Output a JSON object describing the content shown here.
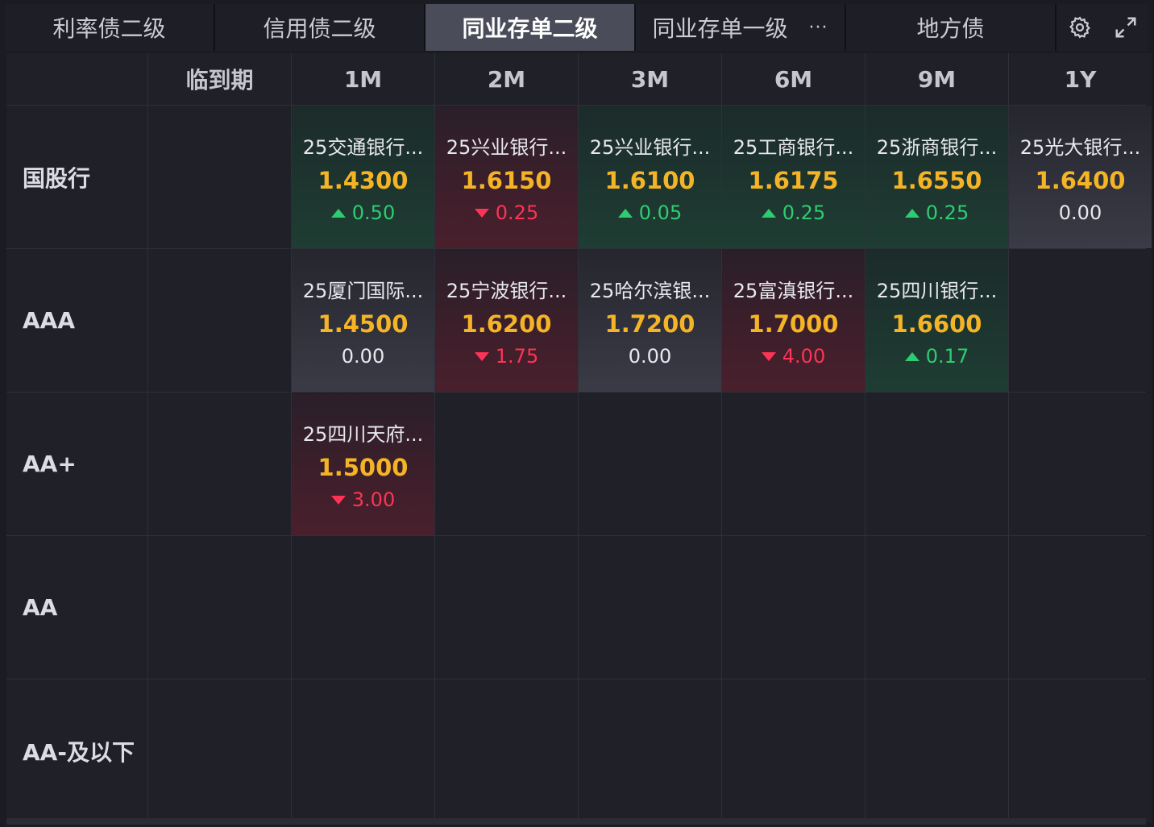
{
  "tabs": [
    {
      "label": "利率债二级",
      "active": false
    },
    {
      "label": "信用债二级",
      "active": false
    },
    {
      "label": "同业存单二级",
      "active": true
    },
    {
      "label": "同业存单一级",
      "active": false,
      "more": "···"
    },
    {
      "label": "地方债",
      "active": false
    }
  ],
  "tools": {
    "settings_icon": "gear-icon",
    "expand_icon": "expand-icon"
  },
  "columns": [
    "临到期",
    "1M",
    "2M",
    "3M",
    "6M",
    "9M",
    "1Y"
  ],
  "rows": [
    {
      "label": "国股行",
      "cells": [
        null,
        {
          "bond": "25交通银行...",
          "yield": "1.4300",
          "change": "0.50",
          "dir": "up"
        },
        {
          "bond": "25兴业银行...",
          "yield": "1.6150",
          "change": "0.25",
          "dir": "down"
        },
        {
          "bond": "25兴业银行...",
          "yield": "1.6100",
          "change": "0.05",
          "dir": "up"
        },
        {
          "bond": "25工商银行...",
          "yield": "1.6175",
          "change": "0.25",
          "dir": "up"
        },
        {
          "bond": "25浙商银行...",
          "yield": "1.6550",
          "change": "0.25",
          "dir": "up"
        },
        {
          "bond": "25光大银行...",
          "yield": "1.6400",
          "change": "0.00",
          "dir": "flat"
        }
      ]
    },
    {
      "label": "AAA",
      "cells": [
        null,
        {
          "bond": "25厦门国际...",
          "yield": "1.4500",
          "change": "0.00",
          "dir": "flat"
        },
        {
          "bond": "25宁波银行...",
          "yield": "1.6200",
          "change": "1.75",
          "dir": "down"
        },
        {
          "bond": "25哈尔滨银...",
          "yield": "1.7200",
          "change": "0.00",
          "dir": "flat"
        },
        {
          "bond": "25富滇银行...",
          "yield": "1.7000",
          "change": "4.00",
          "dir": "down"
        },
        {
          "bond": "25四川银行...",
          "yield": "1.6600",
          "change": "0.17",
          "dir": "up"
        },
        null
      ]
    },
    {
      "label": "AA+",
      "cells": [
        null,
        {
          "bond": "25四川天府...",
          "yield": "1.5000",
          "change": "3.00",
          "dir": "down"
        },
        null,
        null,
        null,
        null,
        null
      ]
    },
    {
      "label": "AA",
      "cells": [
        null,
        null,
        null,
        null,
        null,
        null,
        null
      ]
    },
    {
      "label": "AA-及以下",
      "cells": [
        null,
        null,
        null,
        null,
        null,
        null,
        null
      ]
    }
  ],
  "colors": {
    "up": "#2ecc71",
    "down": "#ff3355",
    "yield": "#f5b426",
    "active_tab": "#4a4c59"
  }
}
